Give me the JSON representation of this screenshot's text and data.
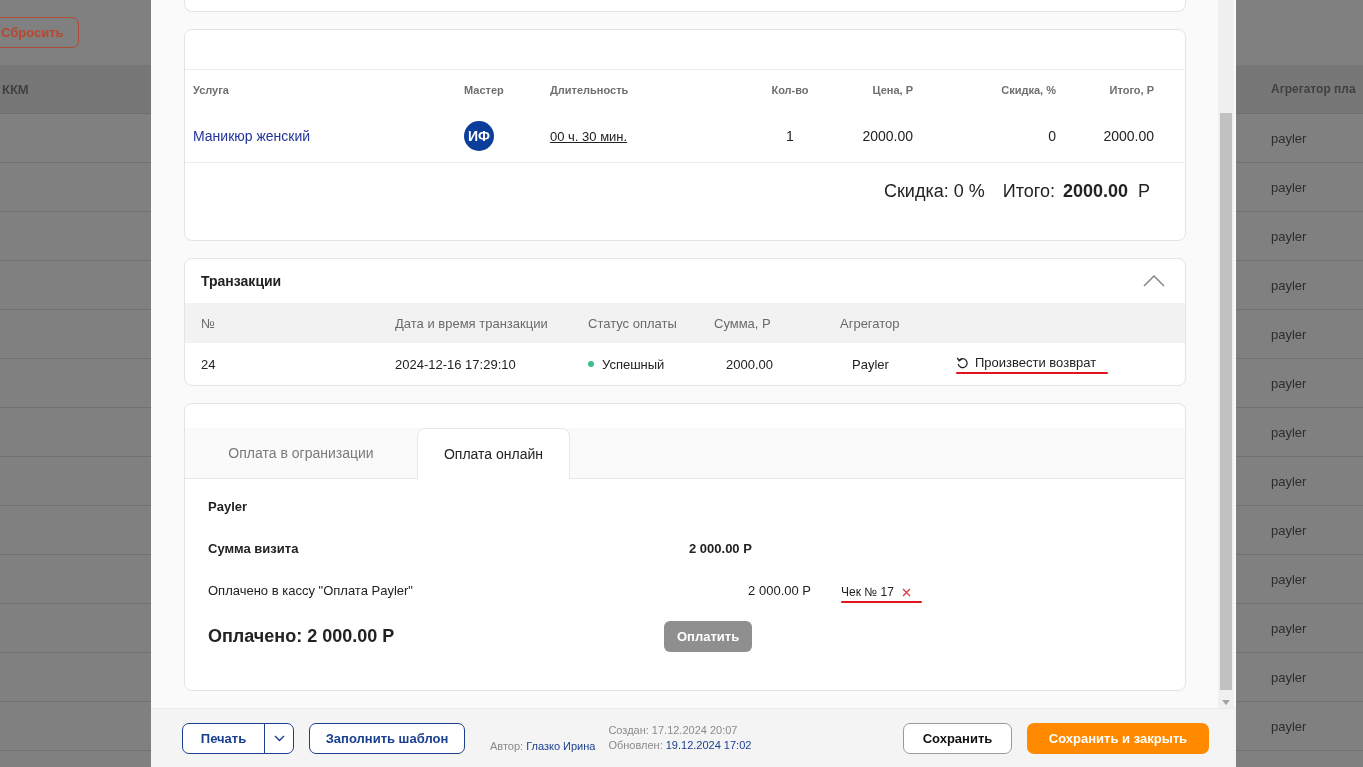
{
  "background": {
    "reset_button": "Сбросить",
    "left_header": "ККМ",
    "right_header": "Агрегатор пла",
    "rows": [
      "payler",
      "payler",
      "payler",
      "payler",
      "payler",
      "payler",
      "payler",
      "payler",
      "payler",
      "payler",
      "payler",
      "payler",
      "payler"
    ]
  },
  "services": {
    "columns": [
      "Услуга",
      "Мастер",
      "Длительность",
      "Кол-во",
      "Цена, Р",
      "Скидка, %",
      "Итого, Р"
    ],
    "rows": [
      {
        "service": "Маникюр женский",
        "master": "ИФ",
        "duration": "00 ч. 30 мин.",
        "qty": "1",
        "price": "2000.00",
        "discount": "0",
        "total": "2000.00"
      }
    ],
    "discount": "Скидка: 0 %",
    "total_label": "Итого:",
    "total_value": "2000.00",
    "currency": "Р"
  },
  "transactions": {
    "title": "Транзакции",
    "expanded": true,
    "columns": [
      "№",
      "Дата и время транзакции",
      "Статус оплаты",
      "Сумма, Р",
      "Агрегатор"
    ],
    "rows": [
      {
        "number": "24",
        "datetime": "2024-12-16 17:29:10",
        "status": "Успешный",
        "color": "#3cc08a",
        "sum": "2000.00",
        "aggregator": "Payler",
        "action": "Произвести возврат",
        "marked": true
      }
    ]
  },
  "payment": {
    "tabs": [
      {
        "label": "Оплата в огранизации",
        "selected": false
      },
      {
        "label": "Оплата онлайн",
        "selected": true
      }
    ],
    "provider": "Payler",
    "visit_label": "Сумма визита",
    "visit_sum": "2 000.00 Р",
    "paid_label": "Оплачено в кассу \"Оплата Payler\"",
    "paid_amount": "2 000.00 Р",
    "receipt": "Чек № 17",
    "receipt_marked": true,
    "paid_total": "Оплачено: 2 000.00 Р",
    "pay_button": {
      "label": "Оплатить",
      "disabled": true
    }
  },
  "footer": {
    "print": "Печать",
    "template": "Заполнить шаблон",
    "author_label": "Автор:",
    "author": "Глазко Ирина",
    "created_label": "Создан:",
    "created": "17.12.2024 20:07",
    "updated_label": "Обновлен:",
    "updated": "19.12.2024 17:02",
    "save": "Сохранить",
    "save_close": "Сохранить и закрыть"
  }
}
